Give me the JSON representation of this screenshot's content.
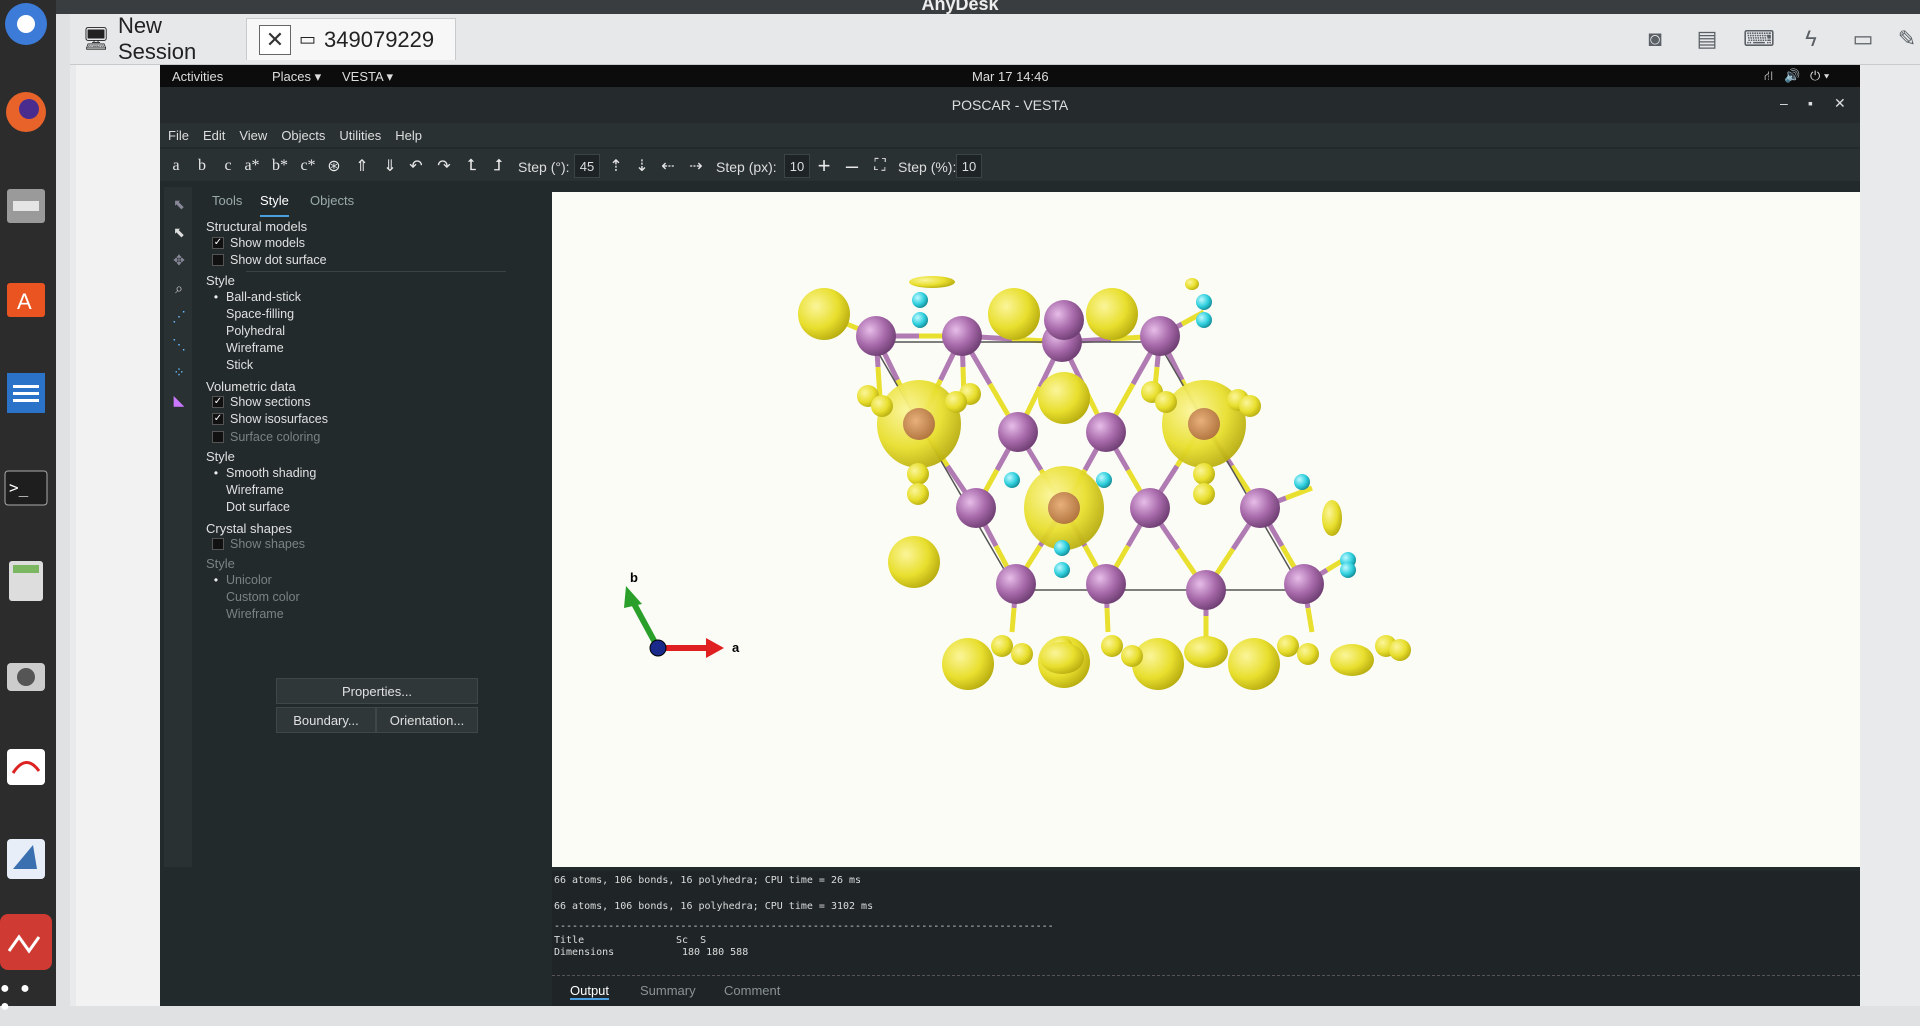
{
  "anydesk": {
    "title": "AnyDesk",
    "tabs": [
      {
        "label": "New Session"
      },
      {
        "label": "349079229"
      }
    ],
    "tools": [
      "display-icon",
      "chat-icon",
      "keyboard-icon",
      "lightning-icon",
      "monitor-icon"
    ]
  },
  "dock": {
    "apps": [
      "chromium",
      "firefox",
      "files",
      "software-center",
      "writer",
      "terminal",
      "calculator",
      "camera",
      "pdf-viewer",
      "vesta",
      "anydesk",
      "app-grid"
    ]
  },
  "gnome": {
    "activities": "Activities",
    "places": "Places ▾",
    "app": "VESTA ▾",
    "datetime": "Mar 17  14:46"
  },
  "vesta": {
    "window_title": "POSCAR - VESTA",
    "menu": [
      "File",
      "Edit",
      "View",
      "Objects",
      "Utilities",
      "Help"
    ],
    "toolbar": {
      "axis_buttons": [
        "a",
        "b",
        "c",
        "a*",
        "b*",
        "c*"
      ],
      "step_deg_label": "Step (°):",
      "step_deg_value": "45",
      "step_px_label": "Step (px):",
      "step_px_value": "10",
      "step_pct_label": "Step (%):",
      "step_pct_value": "10"
    },
    "panel_tabs": [
      "Tools",
      "Style",
      "Objects"
    ],
    "panel": {
      "structural_models": "Structural models",
      "show_models": "Show models",
      "show_dot_surface": "Show dot surface",
      "style1": "Style",
      "ball_and_stick": "Ball-and-stick",
      "space_filling": "Space-filling",
      "polyhedral": "Polyhedral",
      "wireframe1": "Wireframe",
      "stick": "Stick",
      "volumetric_data": "Volumetric data",
      "show_sections": "Show sections",
      "show_isosurfaces": "Show isosurfaces",
      "surface_coloring": "Surface coloring",
      "style2": "Style",
      "smooth_shading": "Smooth shading",
      "wireframe2": "Wireframe",
      "dot_surface": "Dot surface",
      "crystal_shapes": "Crystal shapes",
      "show_shapes": "Show shapes",
      "style3": "Style",
      "unicolor": "Unicolor",
      "custom_color": "Custom color",
      "wireframe3": "Wireframe",
      "properties_btn": "Properties...",
      "boundary_btn": "Boundary...",
      "orientation_btn": "Orientation..."
    },
    "axes": {
      "a": "a",
      "b": "b"
    },
    "log": {
      "line1": "66 atoms, 106 bonds, 16 polyhedra; CPU time = 26 ms",
      "line2": "66 atoms, 106 bonds, 16 polyhedra; CPU time = 3102 ms",
      "rule": "-----------------------------------------------------------------------------------",
      "title_key": "Title",
      "title_val": "Sc  S",
      "dim_key": "Dimensions",
      "dim_val": "180 180 588"
    },
    "bottom_tabs": [
      "Output",
      "Summary",
      "Comment"
    ],
    "colors": {
      "sulfur": "#f0e61e",
      "scandium": "#b07ab2",
      "isosurface": "#e8e23a",
      "cyan": "#30d6e0"
    }
  }
}
